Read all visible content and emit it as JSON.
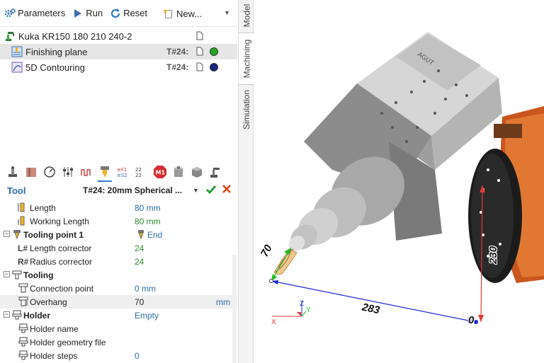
{
  "toolbar": {
    "parameters_label": "Parameters",
    "run_label": "Run",
    "reset_label": "Reset",
    "new_label": "New..."
  },
  "tree": {
    "robot": "Kuka KR150 180 210 240-2",
    "items": [
      {
        "label": "Finishing plane",
        "tool_code": "T#24:",
        "status_color": "#22aa22"
      },
      {
        "label": "5D Contouring",
        "tool_code": "T#24:",
        "status_color": "#1a237e"
      }
    ]
  },
  "tool_panel": {
    "title": "Tool",
    "selected_tool": "T#24: 20mm Spherical ..."
  },
  "properties": {
    "length_label": "Length",
    "length_value": "80 mm",
    "working_length_label": "Working Length",
    "working_length_value": "80 mm",
    "tooling_point_label": "Tooling point 1",
    "tooling_point_value": "End",
    "length_corrector_prefix": "L#",
    "length_corrector_label": "Length corrector",
    "length_corrector_value": "24",
    "radius_corrector_prefix": "R#",
    "radius_corrector_label": "Radius corrector",
    "radius_corrector_value": "24",
    "tooling_label": "Tooling",
    "connection_point_label": "Connection point",
    "connection_point_value": "0 mm",
    "overhang_label": "Overhang",
    "overhang_value": "70",
    "overhang_unit": "mm",
    "holder_label": "Holder",
    "holder_value": "Empty",
    "holder_name_label": "Holder name",
    "holder_geometry_label": "Holder geometry file",
    "holder_steps_label": "Holder steps",
    "holder_steps_value": "0"
  },
  "side_tabs": {
    "model": "Model",
    "machining": "Machining",
    "simulation": "Simulation"
  },
  "viewport": {
    "dim_overhang": "70",
    "dim_horizontal": "283",
    "dim_vertical": "230",
    "dim_origin": "0",
    "axis_x": "X",
    "axis_y": "Y",
    "axis_z": "Z",
    "engraving": "AGUT"
  }
}
